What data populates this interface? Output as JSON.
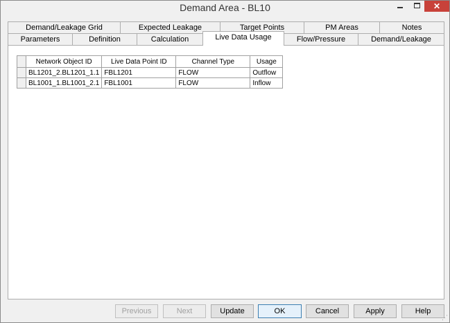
{
  "window": {
    "title": "Demand Area - BL10",
    "minimize_glyph": "",
    "maximize_glyph": "",
    "close_glyph": "✕"
  },
  "tabs": {
    "row1": [
      "Demand/Leakage Grid",
      "Expected Leakage",
      "Target Points",
      "PM Areas",
      "Notes"
    ],
    "row2": [
      "Parameters",
      "Definition",
      "Calculation",
      "Live Data Usage",
      "Flow/Pressure",
      "Demand/Leakage"
    ],
    "active": "Live Data Usage"
  },
  "grid": {
    "columns": [
      "Network Object ID",
      "Live Data Point ID",
      "Channel Type",
      "Usage"
    ],
    "rows": [
      [
        "BL1201_2.BL1201_1.1",
        "FBL1201",
        "FLOW",
        "Outflow"
      ],
      [
        "BL1001_1.BL1001_2.1",
        "FBL1001",
        "FLOW",
        "Inflow"
      ]
    ]
  },
  "buttons": {
    "previous": "Previous",
    "next": "Next",
    "update": "Update",
    "ok": "OK",
    "cancel": "Cancel",
    "apply": "Apply",
    "help": "Help"
  }
}
